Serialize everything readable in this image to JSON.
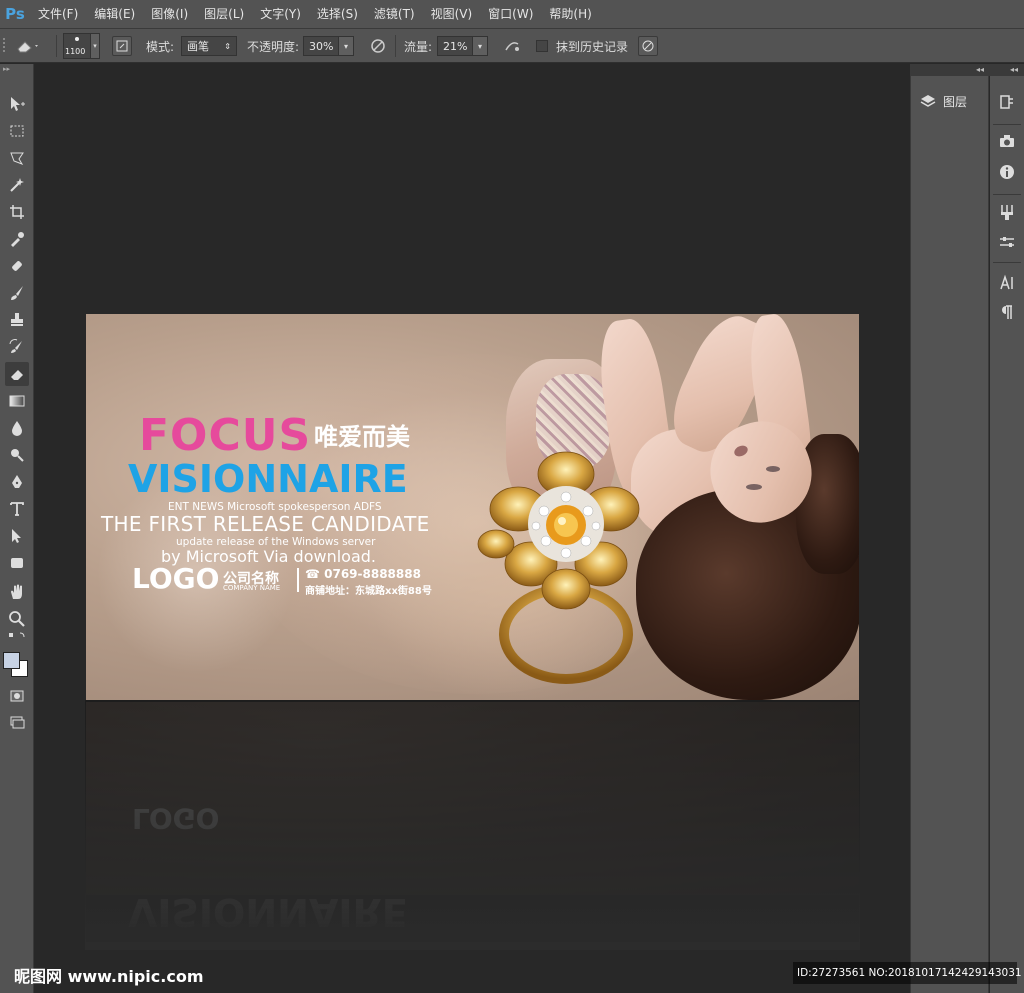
{
  "app": {
    "logo": "Ps",
    "accent": "#4aa3df"
  },
  "menu": [
    "文件(F)",
    "编辑(E)",
    "图像(I)",
    "图层(L)",
    "文字(Y)",
    "选择(S)",
    "滤镜(T)",
    "视图(V)",
    "窗口(W)",
    "帮助(H)"
  ],
  "options": {
    "brush_size": "1100",
    "mode_label": "模式:",
    "mode_value": "画笔",
    "opacity_label": "不透明度:",
    "opacity_value": "30%",
    "flow_label": "流量:",
    "flow_value": "21%",
    "erase_history_label": "抹到历史记录",
    "erase_history_checked": false
  },
  "panels": {
    "layers_label": "图层"
  },
  "banner": {
    "focus": "FOCUS",
    "cn_title": "唯爱而美",
    "visionnaire": "VISIONNAIRE",
    "ent_news": "ENT NEWS Microsoft spokesperson ADFS",
    "release": "THE FIRST RELEASE CANDIDATE",
    "update": "update release of the Windows server",
    "via": "by Microsoft Via download.",
    "logo": "LOGO",
    "company": "公司名称",
    "company_en": "COMPANY NAME",
    "phone": "☎ 0769-8888888",
    "address": "商铺地址：东城路xx街88号",
    "colors": {
      "focus": "#e64a9c",
      "visionnaire": "#1ea3e6",
      "background": "#c2a897"
    }
  },
  "watermark": {
    "left": "昵图网 www.nipic.com",
    "right": "ID:27273561 NO:20181017142429143031"
  }
}
